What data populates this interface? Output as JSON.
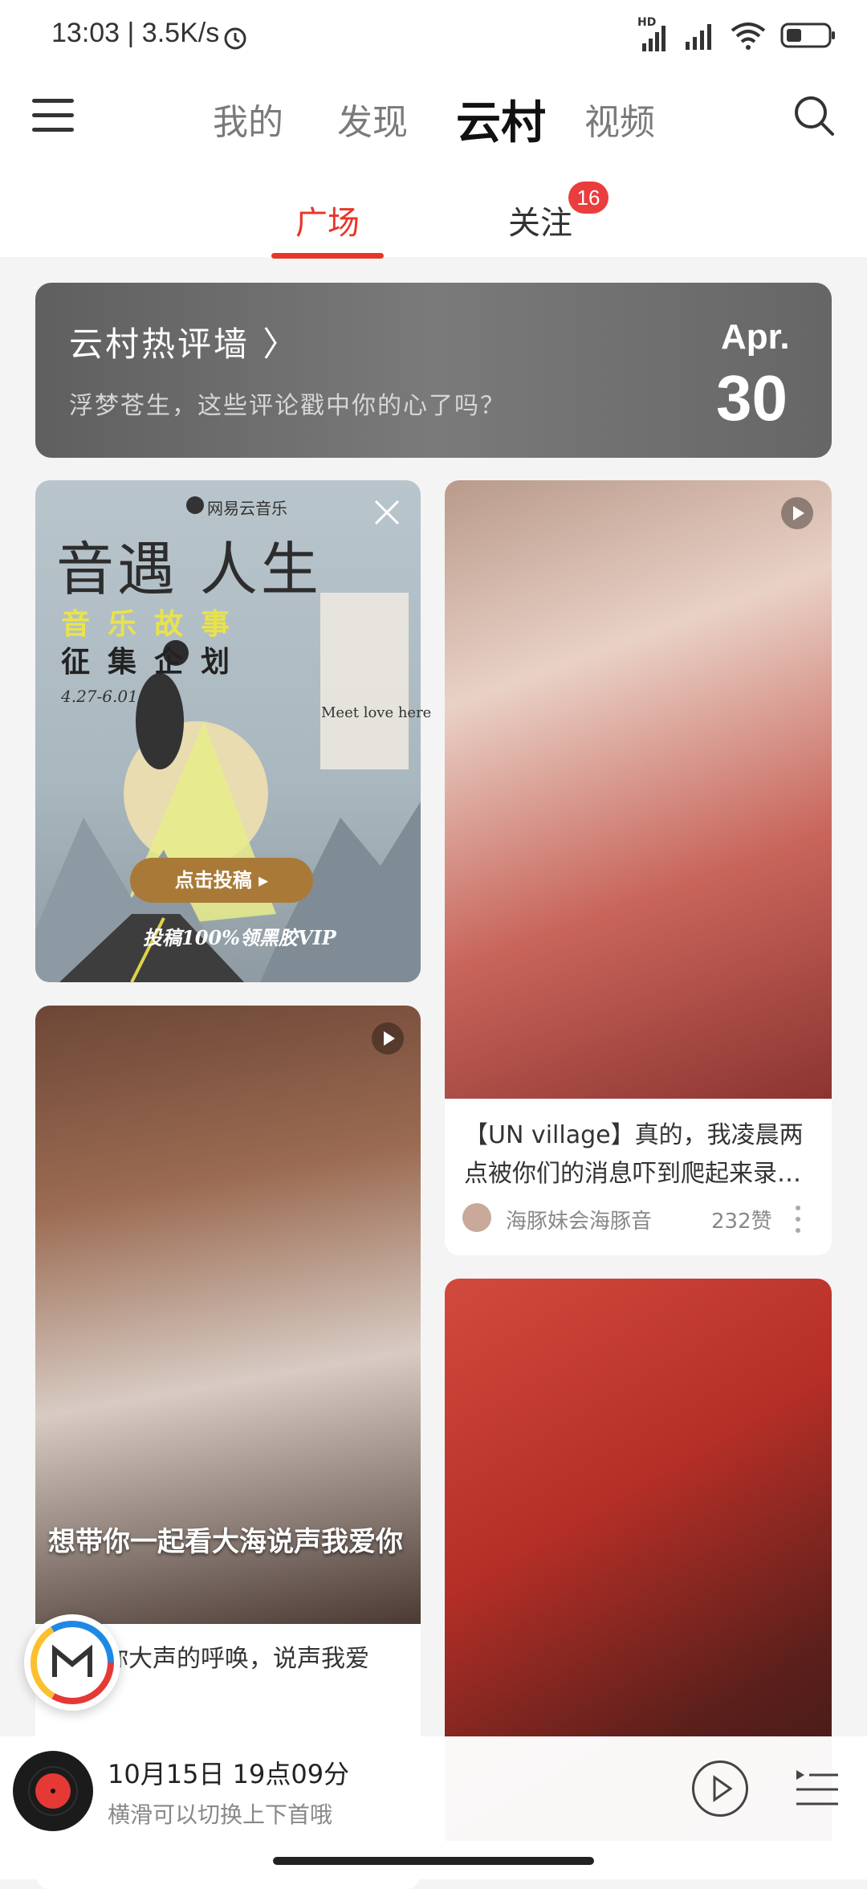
{
  "status": {
    "time_speed": "13:03 | 3.5K/s",
    "hd_label": "HD"
  },
  "nav": {
    "tabs": [
      {
        "label": "我的"
      },
      {
        "label": "发现"
      },
      {
        "label": "云村"
      },
      {
        "label": "视频"
      }
    ],
    "active_tab": "云村"
  },
  "subtabs": {
    "items": [
      {
        "label": "广场"
      },
      {
        "label": "关注"
      }
    ],
    "follow_badge": "16"
  },
  "banner": {
    "title": "云村热评墙 〉",
    "subtitle": "浮梦苍生，这些评论戳中你的心了吗？",
    "month": "Apr.",
    "day": "30"
  },
  "promo": {
    "brand": "网易云音乐",
    "title": "音遇 人生",
    "line_yellow": "音乐故事",
    "line_black": "征集企划",
    "date_range": "4.27-6.01",
    "meet_text": "Meet love here",
    "button": "点击投稿 ▸",
    "vip_text": "投稿100%领黑胶VIP"
  },
  "card_right_1": {
    "text": "【UN village】真的，我凌晨两点被你们的消息吓到爬起来录…",
    "author": "海豚妹会海豚音",
    "likes": "232赞"
  },
  "card_left_2": {
    "caption": "想带你一起看大海说声我爱你",
    "text": "你大声的呼唤，说声我爱"
  },
  "player": {
    "title": "10月15日 19点09分",
    "subtitle": "横滑可以切换上下首哦"
  },
  "colors": {
    "accent": "#e8352a",
    "badge": "#ea3d3d"
  }
}
